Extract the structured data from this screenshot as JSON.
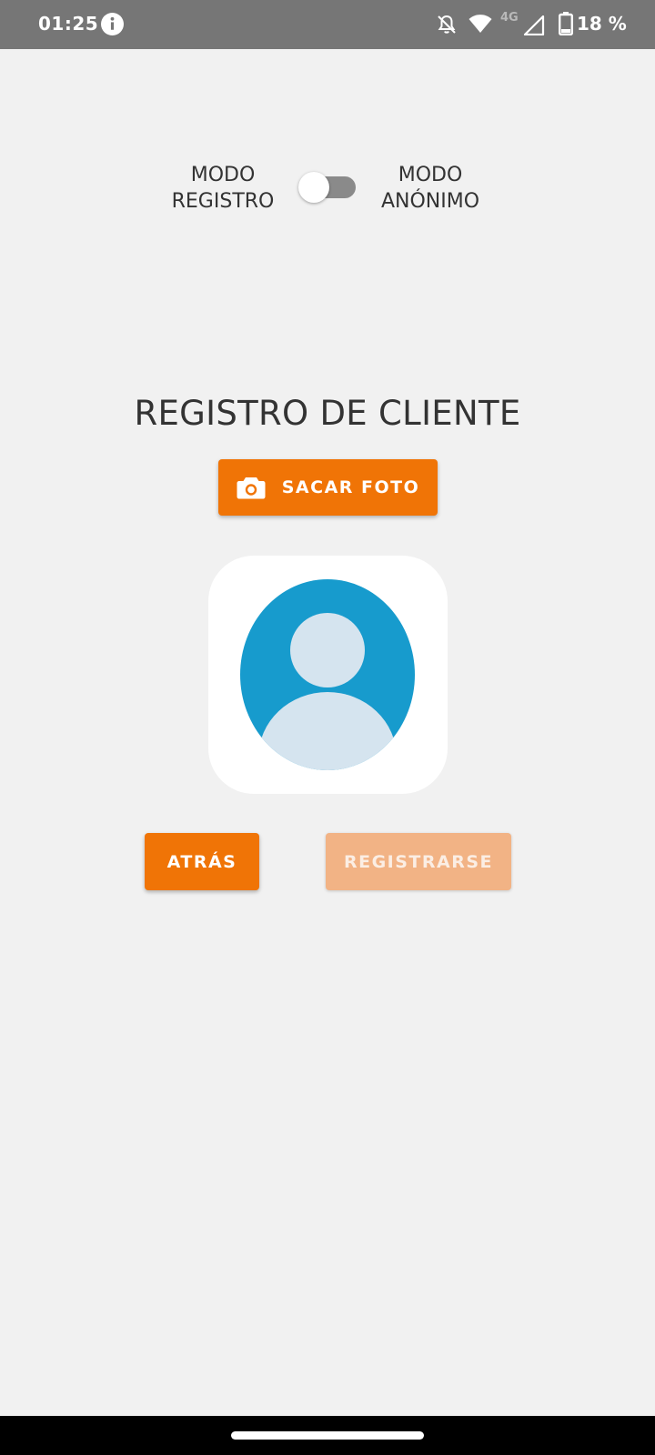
{
  "status_bar": {
    "time": "01:25",
    "network_type": "4G",
    "battery_percent": "18 %",
    "icons": [
      "info-icon",
      "bell-off-icon",
      "wifi-icon",
      "signal-icon",
      "battery-icon"
    ]
  },
  "mode_toggle": {
    "left_label_line1": "MODO",
    "left_label_line2": "REGISTRO",
    "right_label_line1": "MODO",
    "right_label_line2": "ANÓNIMO",
    "state": "off"
  },
  "page": {
    "title": "REGISTRO DE CLIENTE"
  },
  "buttons": {
    "take_photo": "SACAR FOTO",
    "back": "ATRÁS",
    "register": "REGISTRARSE",
    "register_enabled": false
  },
  "colors": {
    "accent": "#f07406",
    "accent_disabled": "#f2b385",
    "avatar_bg": "#179bcd",
    "avatar_figure": "#d5e4ef",
    "background": "#f1f1f1",
    "status_bar": "#767676"
  }
}
